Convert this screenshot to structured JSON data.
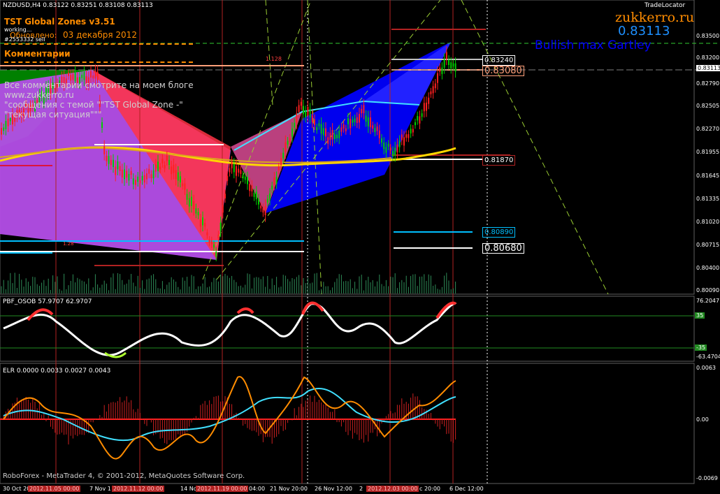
{
  "header": {
    "symbol_info": "NZDUSD,H4  0.83122  0.83251  0.83108  0.83113",
    "trade_locator": "TradeLocator",
    "zukkerro": "zukkerro.ru",
    "current_price": "0.83113",
    "pattern": "Bullish max Gartley"
  },
  "zones": {
    "title": "TST Global Zones  v3.51",
    "working": "working...",
    "updated_label": "Обновлено:",
    "updated_date": "03 декабря 2012",
    "ticket": "#2553332 sell",
    "comments_title": "Комментарии",
    "comments": [
      "Все комментарии смотрите на моем блоге",
      "www.zukkerro.ru",
      "\"сообщения с темой \"\"TST Global Zone -\"",
      "\"текущая ситуация\"\"\""
    ]
  },
  "main_chart": {
    "fib_label": "1.128",
    "small_label": "1.28",
    "price_axis": [
      "0.83500",
      "0.83200",
      "0.83113",
      "0.82790",
      "0.82505",
      "0.82270",
      "0.81955",
      "0.81645",
      "0.81335",
      "0.81020",
      "0.80715",
      "0.80400",
      "0.80090"
    ],
    "tags": [
      {
        "text": "0.83240",
        "color": "#c0c0c0"
      },
      {
        "text": "0.83080",
        "color": "#ffa07a"
      },
      {
        "text": "0.81870",
        "color": "#ffffff"
      },
      {
        "text": "0.80890",
        "color": "#00bfff"
      },
      {
        "text": "0.80680",
        "color": "#ffffff"
      }
    ]
  },
  "osc1": {
    "label": "PBF_OSOB 57.9707 62.9707",
    "top": "76.2047",
    "bottom": "-63.4704",
    "level_hi": "35",
    "level_lo": "-35"
  },
  "osc2": {
    "label": "ELR 0.0000 0.0033 0.0027 0.0043",
    "top": "0.0063",
    "zero": "0.00",
    "bottom": "-0.0069"
  },
  "footer": {
    "copyright": "RoboForex - MetaTrader 4, © 2001-2012, MetaQuotes Software Corp.",
    "time_labels": [
      "30 Oct 20",
      "7 Nov 1",
      "14 No",
      "04:00",
      "21 Nov 20:00",
      "26 Nov 12:00",
      "2",
      "c 20:00",
      "6 Dec 12:00"
    ],
    "red_dates": [
      "2012.11.05 00:00",
      "2012.11.12 00:00",
      "2012.11.19 00:00",
      "2012.12.03 00:00"
    ]
  },
  "colors": {
    "purple": "#b44ee8",
    "red_zone": "#ff3344",
    "blue_zone": "#0000ee",
    "green_zone": "#008000",
    "ma_yellow": "#ffd700",
    "cyan": "#40e0ff",
    "orange": "#ff8c00"
  }
}
